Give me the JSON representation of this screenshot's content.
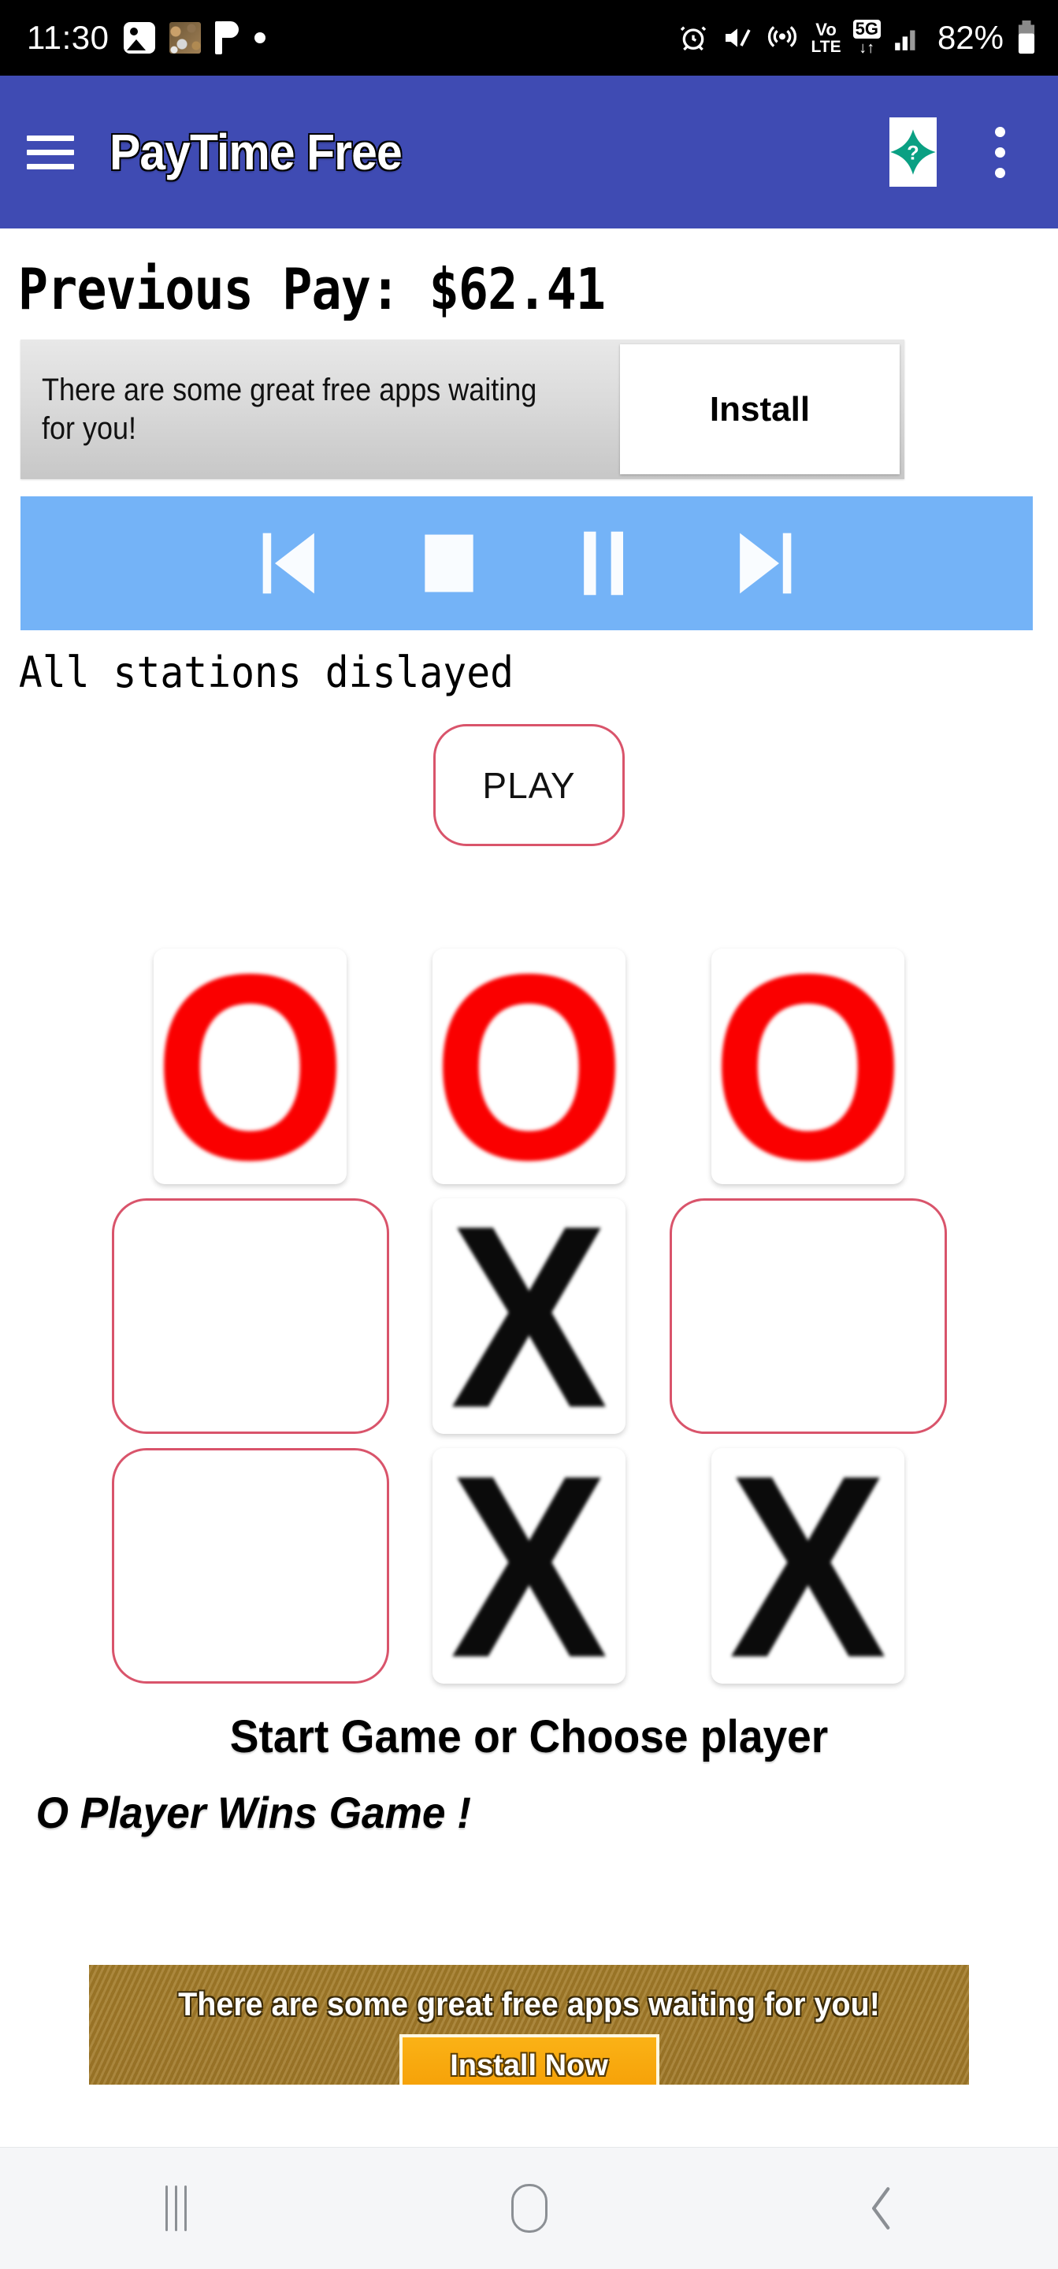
{
  "status_bar": {
    "time": "11:30",
    "battery_percent": "82%",
    "left_icons": [
      "photo-icon",
      "noise-thumbnail-icon",
      "flag-icon",
      "dot-icon"
    ],
    "right_icons": [
      "alarm-icon",
      "mute-icon",
      "hotspot-icon",
      "volte-icon",
      "5g-icon",
      "signal-icon",
      "battery-icon"
    ],
    "volte_label_top": "Vo",
    "volte_label_bottom": "LTE",
    "network_label": "5G",
    "background": "#000000"
  },
  "app_bar": {
    "title": "PayTime Free",
    "menu_icon": "hamburger-icon",
    "help_icon": "help-question-icon",
    "help_symbol": "?",
    "overflow_icon": "overflow-menu-icon",
    "background": "#3f4bb3"
  },
  "main": {
    "previous_pay": "Previous Pay: $62.41",
    "top_ad": {
      "text": "There are some great free apps waiting for you!",
      "button_label": "Install"
    },
    "media_controls": {
      "background": "#74b3f7",
      "buttons": [
        {
          "name": "previous-button",
          "icon": "skip-previous-icon"
        },
        {
          "name": "stop-button",
          "icon": "stop-icon"
        },
        {
          "name": "pause-button",
          "icon": "pause-icon"
        },
        {
          "name": "next-button",
          "icon": "skip-next-icon"
        }
      ]
    },
    "stations_status": "All stations dislayed",
    "play_button": "PLAY",
    "board": {
      "accent_color": "#d9546b",
      "o_color": "#fa0000",
      "x_color": "#0b0b0b",
      "cells": [
        {
          "value": "O",
          "state": "filled"
        },
        {
          "value": "O",
          "state": "filled"
        },
        {
          "value": "O",
          "state": "filled"
        },
        {
          "value": "",
          "state": "empty"
        },
        {
          "value": "X",
          "state": "filled"
        },
        {
          "value": "",
          "state": "empty"
        },
        {
          "value": "",
          "state": "empty"
        },
        {
          "value": "X",
          "state": "filled"
        },
        {
          "value": "X",
          "state": "filled"
        }
      ]
    },
    "game_prompt": "Start Game or Choose player",
    "game_result": "O Player Wins Game !",
    "bottom_ad": {
      "text": "There are some great free apps waiting for you!",
      "button_label": "Install Now"
    }
  },
  "nav_bar": {
    "buttons": [
      {
        "name": "recents-button",
        "icon": "recents-icon"
      },
      {
        "name": "home-button",
        "icon": "home-icon"
      },
      {
        "name": "back-button",
        "icon": "back-chevron-icon"
      }
    ]
  }
}
